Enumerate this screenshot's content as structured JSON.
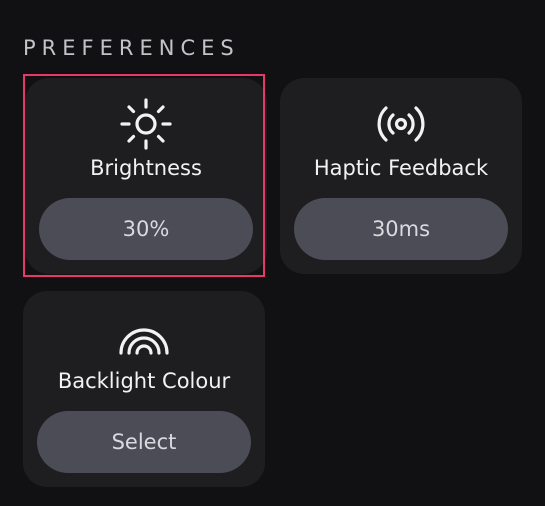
{
  "section": {
    "title": "PREFERENCES"
  },
  "cards": {
    "brightness": {
      "label": "Brightness",
      "value": "30%",
      "icon": "sun-icon"
    },
    "haptic": {
      "label": "Haptic Feedback",
      "value": "30ms",
      "icon": "vibration-icon"
    },
    "backlight": {
      "label": "Backlight Colour",
      "value": "Select",
      "icon": "rainbow-icon"
    }
  },
  "colors": {
    "background": "#111114",
    "card": "#1e1e21",
    "pill": "#4c4c57",
    "selection": "#e8386a"
  }
}
